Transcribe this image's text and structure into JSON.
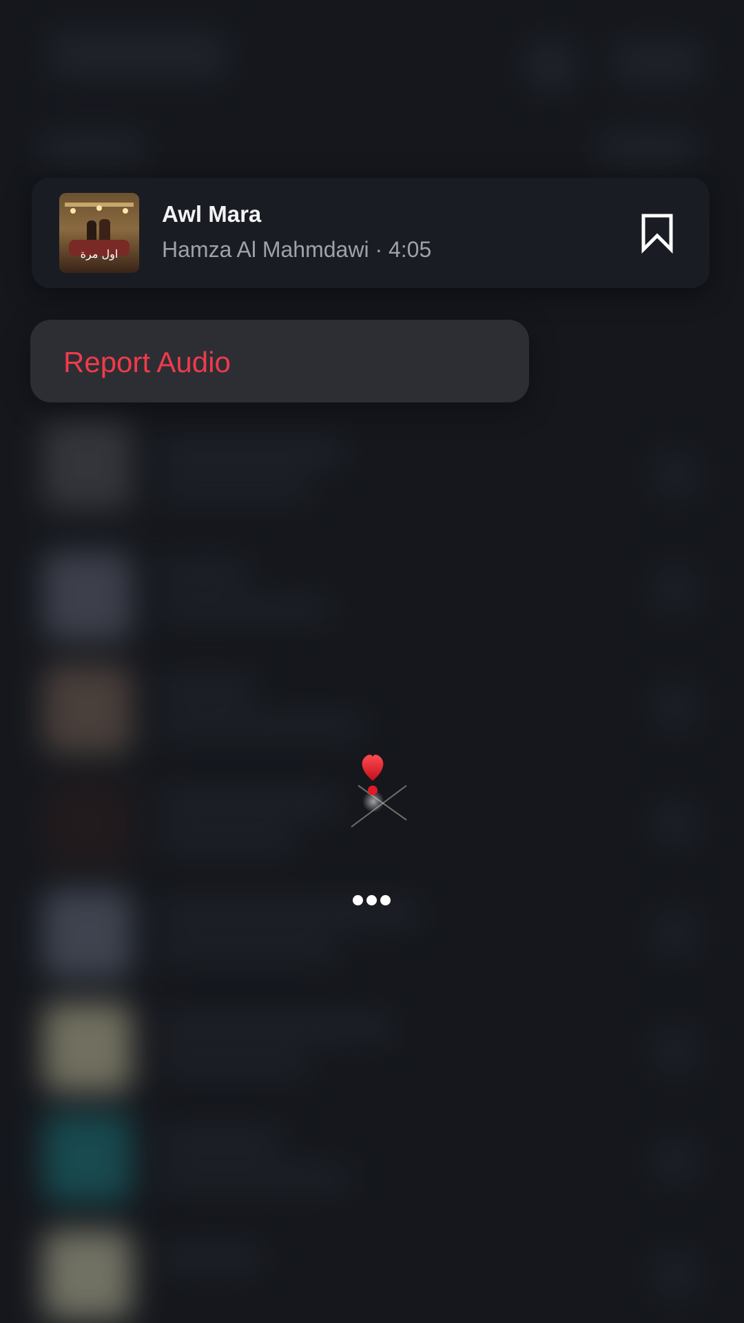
{
  "audio": {
    "title": "Awl Mara",
    "artist": "Hamza Al Mahmdawi",
    "separator": " · ",
    "duration": "4:05",
    "cover_icon": "album-cover-image",
    "save_icon": "bookmark-icon"
  },
  "menu": {
    "items": [
      {
        "label": "Report Audio",
        "color": "#ef3b4c"
      }
    ]
  },
  "overlay": {
    "reaction_icon": "heart-exclamation-icon",
    "more_icon": "more-dots-icon"
  },
  "colors": {
    "background": "#1b1d24",
    "card": "#1a1c23",
    "menu": "#2d2e33",
    "destructive": "#ef3b4c",
    "secondary_text": "#9ea2ab"
  }
}
